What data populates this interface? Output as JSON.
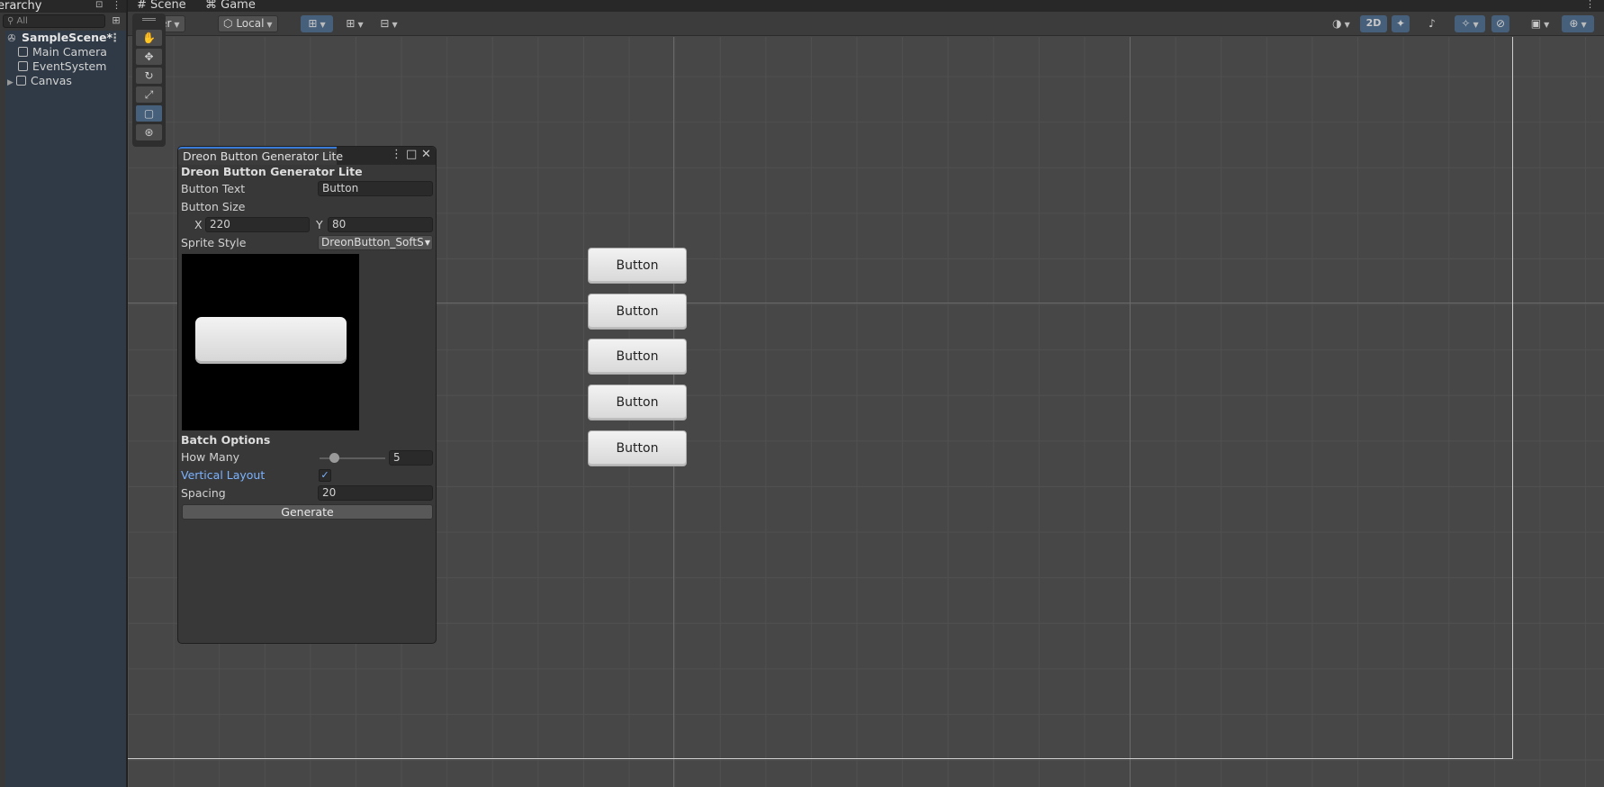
{
  "hierarchy": {
    "title": "erarchy",
    "search_placeholder": "All",
    "scene_name": "SampleScene*",
    "items": [
      {
        "label": "Main Camera"
      },
      {
        "label": "EventSystem"
      },
      {
        "label": "Canvas"
      }
    ]
  },
  "scene_view": {
    "tabs": [
      {
        "label": "Scene",
        "icon": "hash-icon"
      },
      {
        "label": "Game",
        "icon": "gamepad-icon"
      }
    ],
    "toolbar": {
      "pivot_label": "Center",
      "space_label": "Local",
      "mode_2d_label": "2D"
    },
    "scene_buttons": [
      "Button",
      "Button",
      "Button",
      "Button",
      "Button"
    ],
    "accent_color": "#46607c"
  },
  "generator_window": {
    "tab_title": "Dreon Button Generator Lite",
    "heading": "Dreon Button Generator Lite",
    "button_text_label": "Button Text",
    "button_text_value": "Button",
    "button_size_label": "Button Size",
    "size_x_label": "X",
    "size_x_value": "220",
    "size_y_label": "Y",
    "size_y_value": "80",
    "sprite_style_label": "Sprite Style",
    "sprite_style_value": "DreonButton_SoftS",
    "batch_options_label": "Batch Options",
    "how_many_label": "How Many",
    "how_many_value": "5",
    "how_many_slider_fraction": 0.2,
    "vertical_layout_label": "Vertical Layout",
    "vertical_layout_checked": true,
    "spacing_label": "Spacing",
    "spacing_value": "20",
    "generate_label": "Generate"
  }
}
